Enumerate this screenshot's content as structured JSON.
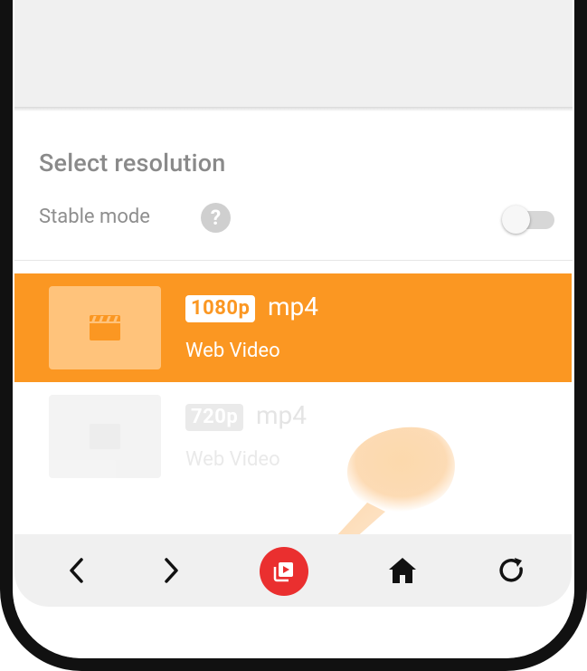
{
  "sheet": {
    "title": "Select resolution",
    "stable_mode_label": "Stable mode",
    "help_glyph": "?",
    "stable_mode_on": false
  },
  "resolutions": [
    {
      "badge": "1080p",
      "format": "mp4",
      "subtitle": "Web Video",
      "selected": true
    },
    {
      "badge": "720p",
      "format": "mp4",
      "subtitle": "Web Video",
      "selected": false
    }
  ],
  "nav": {
    "icons": [
      "chevron-left-icon",
      "chevron-right-icon",
      "video-library-icon",
      "home-icon",
      "refresh-icon"
    ]
  },
  "colors": {
    "accent": "#fb9722",
    "video_button": "#ea2f2f",
    "navbar": "#f0f0f0"
  }
}
